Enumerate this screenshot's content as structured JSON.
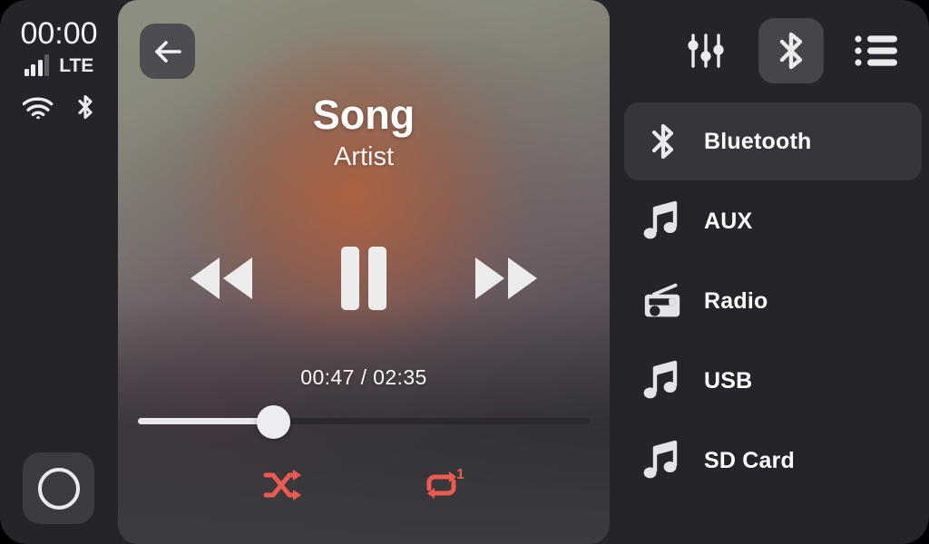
{
  "status": {
    "clock": "00:00",
    "network_label": "LTE",
    "signal_bars_total": 4,
    "signal_bars_filled": 3,
    "wifi_icon": "wifi-icon",
    "bluetooth_icon": "bluetooth-icon",
    "home_button_label": "Home"
  },
  "player": {
    "back_button_label": "Back",
    "title": "Song",
    "artist": "Artist",
    "time_label": "00:47 / 02:35",
    "elapsed": "00:47",
    "duration": "02:35",
    "progress_percent": 30,
    "prev_label": "Previous",
    "play_pause_label": "Pause",
    "play_state": "playing",
    "next_label": "Next",
    "shuffle_label": "Shuffle",
    "repeat_label": "Repeat One",
    "repeat_badge": "1",
    "accent_color": "#ec5a50"
  },
  "toolbar": {
    "equalizer_label": "Equalizer",
    "bluetooth_label": "Bluetooth",
    "playlist_label": "Playlist",
    "active": "Bluetooth"
  },
  "sources": {
    "selected": "Bluetooth",
    "items": [
      {
        "label": "Bluetooth",
        "icon": "bluetooth-icon",
        "active": true
      },
      {
        "label": "AUX",
        "icon": "music-note-icon",
        "active": false
      },
      {
        "label": "Radio",
        "icon": "radio-icon",
        "active": false
      },
      {
        "label": "USB",
        "icon": "music-note-icon",
        "active": false
      },
      {
        "label": "SD Card",
        "icon": "music-note-icon",
        "active": false
      }
    ]
  }
}
